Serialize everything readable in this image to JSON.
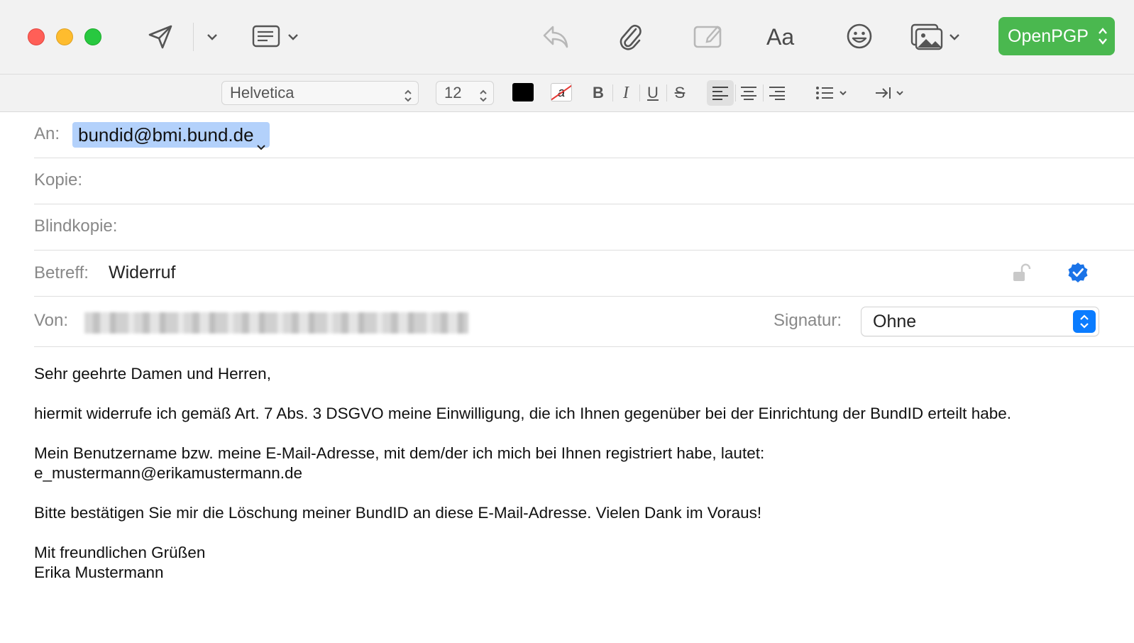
{
  "toolbar": {
    "openpgp_label": "OpenPGP",
    "format_label": "Aa",
    "icons": [
      "send-icon",
      "chevron-down-icon",
      "header-fields-icon",
      "reply-icon",
      "paperclip-icon",
      "markup-icon",
      "emoji-icon",
      "photo-browser-icon"
    ],
    "accent_color": "#4ab84f"
  },
  "formatbar": {
    "font_family": "Helvetica",
    "font_size": "12",
    "bold": "B",
    "italic": "I",
    "underline": "U",
    "strikethrough": "S",
    "bg_sample": "a",
    "text_color": "#000000"
  },
  "fields": {
    "to_label": "An:",
    "to_value": "bundid@bmi.bund.de",
    "cc_label": "Kopie:",
    "bcc_label": "Blindkopie:",
    "subject_label": "Betreff:",
    "subject_value": "Widerruf",
    "from_label": "Von:",
    "signature_label": "Signatur:",
    "signature_value": "Ohne"
  },
  "body": {
    "greeting": "Sehr geehrte Damen und Herren,",
    "p1": "hiermit widerrufe ich gemäß Art. 7 Abs. 3 DSGVO meine Einwilligung, die ich Ihnen gegenüber bei der Einrichtung der BundID erteilt habe.",
    "p2_line1": "Mein Benutzername bzw. meine E-Mail-Adresse, mit dem/der ich mich bei Ihnen registriert habe, lautet:",
    "p2_line2": "e_mustermann@erikamustermann.de",
    "p3": "Bitte bestätigen Sie mir die Löschung meiner BundID an diese E-Mail-Adresse. Vielen Dank im Voraus!",
    "closing": "Mit freundlichen Grüßen",
    "name": "Erika Mustermann"
  }
}
